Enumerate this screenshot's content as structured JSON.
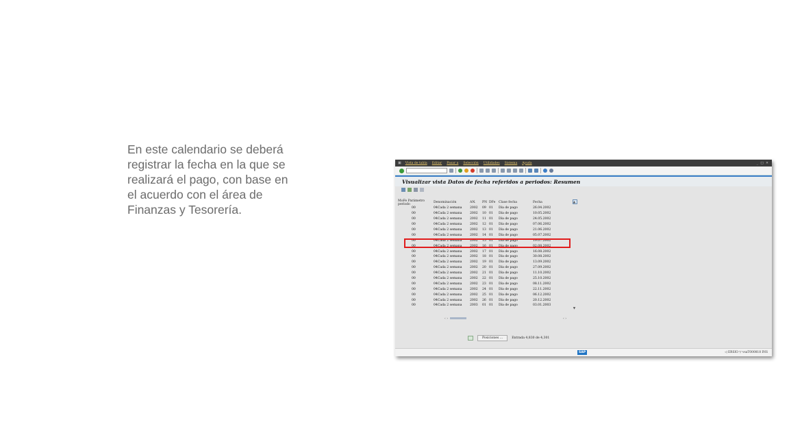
{
  "slide": {
    "text_lines": [
      "En este calendario se deberá",
      "registrar la fecha en la que se",
      "realizará el pago, con base en",
      "el acuerdo con el área de",
      "Finanzas y Tesorería."
    ]
  },
  "sap": {
    "menu": [
      "Vista de tabla",
      "Editar",
      "Pasar a",
      "Selección",
      "Utilidades",
      "Sistema",
      "Ayuda"
    ],
    "window_controls": "_ □ ✕",
    "title": "Visualizar vista Datos de fecha referidos a periodos: Resumen",
    "columns": [
      "MoFe",
      "Parámetro período",
      "Denominación",
      "AN.",
      "PN",
      "DFe",
      "Clase fecha",
      "Fecha"
    ],
    "rows": [
      {
        "mofe": "",
        "param": "00",
        "den": "04Cada 2 semana",
        "an": "2002",
        "pn": "09",
        "dfe": "01",
        "clase": "Día de pago",
        "fecha": "26.04.2002"
      },
      {
        "mofe": "",
        "param": "00",
        "den": "04Cada 2 semana",
        "an": "2002",
        "pn": "10",
        "dfe": "01",
        "clase": "Día de pago",
        "fecha": "10.05.2002"
      },
      {
        "mofe": "",
        "param": "00",
        "den": "04Cada 2 semana",
        "an": "2002",
        "pn": "11",
        "dfe": "01",
        "clase": "Día de pago",
        "fecha": "24.05.2002"
      },
      {
        "mofe": "",
        "param": "00",
        "den": "04Cada 2 semana",
        "an": "2002",
        "pn": "12",
        "dfe": "01",
        "clase": "Día de pago",
        "fecha": "07.06.2002"
      },
      {
        "mofe": "",
        "param": "00",
        "den": "04Cada 2 semana",
        "an": "2002",
        "pn": "13",
        "dfe": "01",
        "clase": "Día de pago",
        "fecha": "21.06.2002"
      },
      {
        "mofe": "",
        "param": "00",
        "den": "04Cada 2 semana",
        "an": "2002",
        "pn": "14",
        "dfe": "01",
        "clase": "Día de pago",
        "fecha": "05.07.2002"
      },
      {
        "mofe": "",
        "param": "00",
        "den": "04Cada 2 semana",
        "an": "2002",
        "pn": "15",
        "dfe": "01",
        "clase": "Día de pago",
        "fecha": "19.07.2002"
      },
      {
        "mofe": "",
        "param": "00",
        "den": "04Cada 2 semana",
        "an": "2002",
        "pn": "16",
        "dfe": "01",
        "clase": "Día de pago",
        "fecha": "02.08.2002"
      },
      {
        "mofe": "",
        "param": "00",
        "den": "04Cada 2 semana",
        "an": "2002",
        "pn": "17",
        "dfe": "01",
        "clase": "Día de pago",
        "fecha": "16.08.2002"
      },
      {
        "mofe": "",
        "param": "00",
        "den": "04Cada 2 semana",
        "an": "2002",
        "pn": "18",
        "dfe": "01",
        "clase": "Día de pago",
        "fecha": "30.08.2002"
      },
      {
        "mofe": "",
        "param": "00",
        "den": "04Cada 2 semana",
        "an": "2002",
        "pn": "19",
        "dfe": "01",
        "clase": "Día de pago",
        "fecha": "13.09.2002"
      },
      {
        "mofe": "",
        "param": "00",
        "den": "04Cada 2 semana",
        "an": "2002",
        "pn": "20",
        "dfe": "01",
        "clase": "Día de pago",
        "fecha": "27.09.2002"
      },
      {
        "mofe": "",
        "param": "00",
        "den": "04Cada 2 semana",
        "an": "2002",
        "pn": "21",
        "dfe": "01",
        "clase": "Día de pago",
        "fecha": "11.10.2002"
      },
      {
        "mofe": "",
        "param": "00",
        "den": "04Cada 2 semana",
        "an": "2002",
        "pn": "22",
        "dfe": "01",
        "clase": "Día de pago",
        "fecha": "25.10.2002"
      },
      {
        "mofe": "",
        "param": "00",
        "den": "04Cada 2 semana",
        "an": "2002",
        "pn": "23",
        "dfe": "01",
        "clase": "Día de pago",
        "fecha": "08.11.2002"
      },
      {
        "mofe": "",
        "param": "00",
        "den": "04Cada 2 semana",
        "an": "2002",
        "pn": "24",
        "dfe": "01",
        "clase": "Día de pago",
        "fecha": "22.11.2002"
      },
      {
        "mofe": "",
        "param": "00",
        "den": "04Cada 2 semana",
        "an": "2002",
        "pn": "25",
        "dfe": "01",
        "clase": "Día de pago",
        "fecha": "06.12.2002"
      },
      {
        "mofe": "",
        "param": "00",
        "den": "04Cada 2 semana",
        "an": "2002",
        "pn": "26",
        "dfe": "01",
        "clase": "Día de pago",
        "fecha": "20.12.2002"
      },
      {
        "mofe": "",
        "param": "00",
        "den": "04Cada 2 semana",
        "an": "2003",
        "pn": "01",
        "dfe": "01",
        "clase": "Día de pago",
        "fecha": "03.01.2003"
      }
    ],
    "positions_button": "Posiciones ...",
    "entry_text": "Entrada 4,830 de 4,301",
    "status_right": "◁ ERSIO ▽  vsaT000818  INS"
  },
  "icons": {
    "ok": "check-circle-icon",
    "scroll_up": "▲",
    "scroll_down": "▼",
    "h_left": "‹ ›",
    "h_right": "‹ ›"
  },
  "colors": {
    "highlight": "#e01b1b",
    "menubar": "#3b3b3b",
    "accent_blue": "#3c7ec7"
  }
}
